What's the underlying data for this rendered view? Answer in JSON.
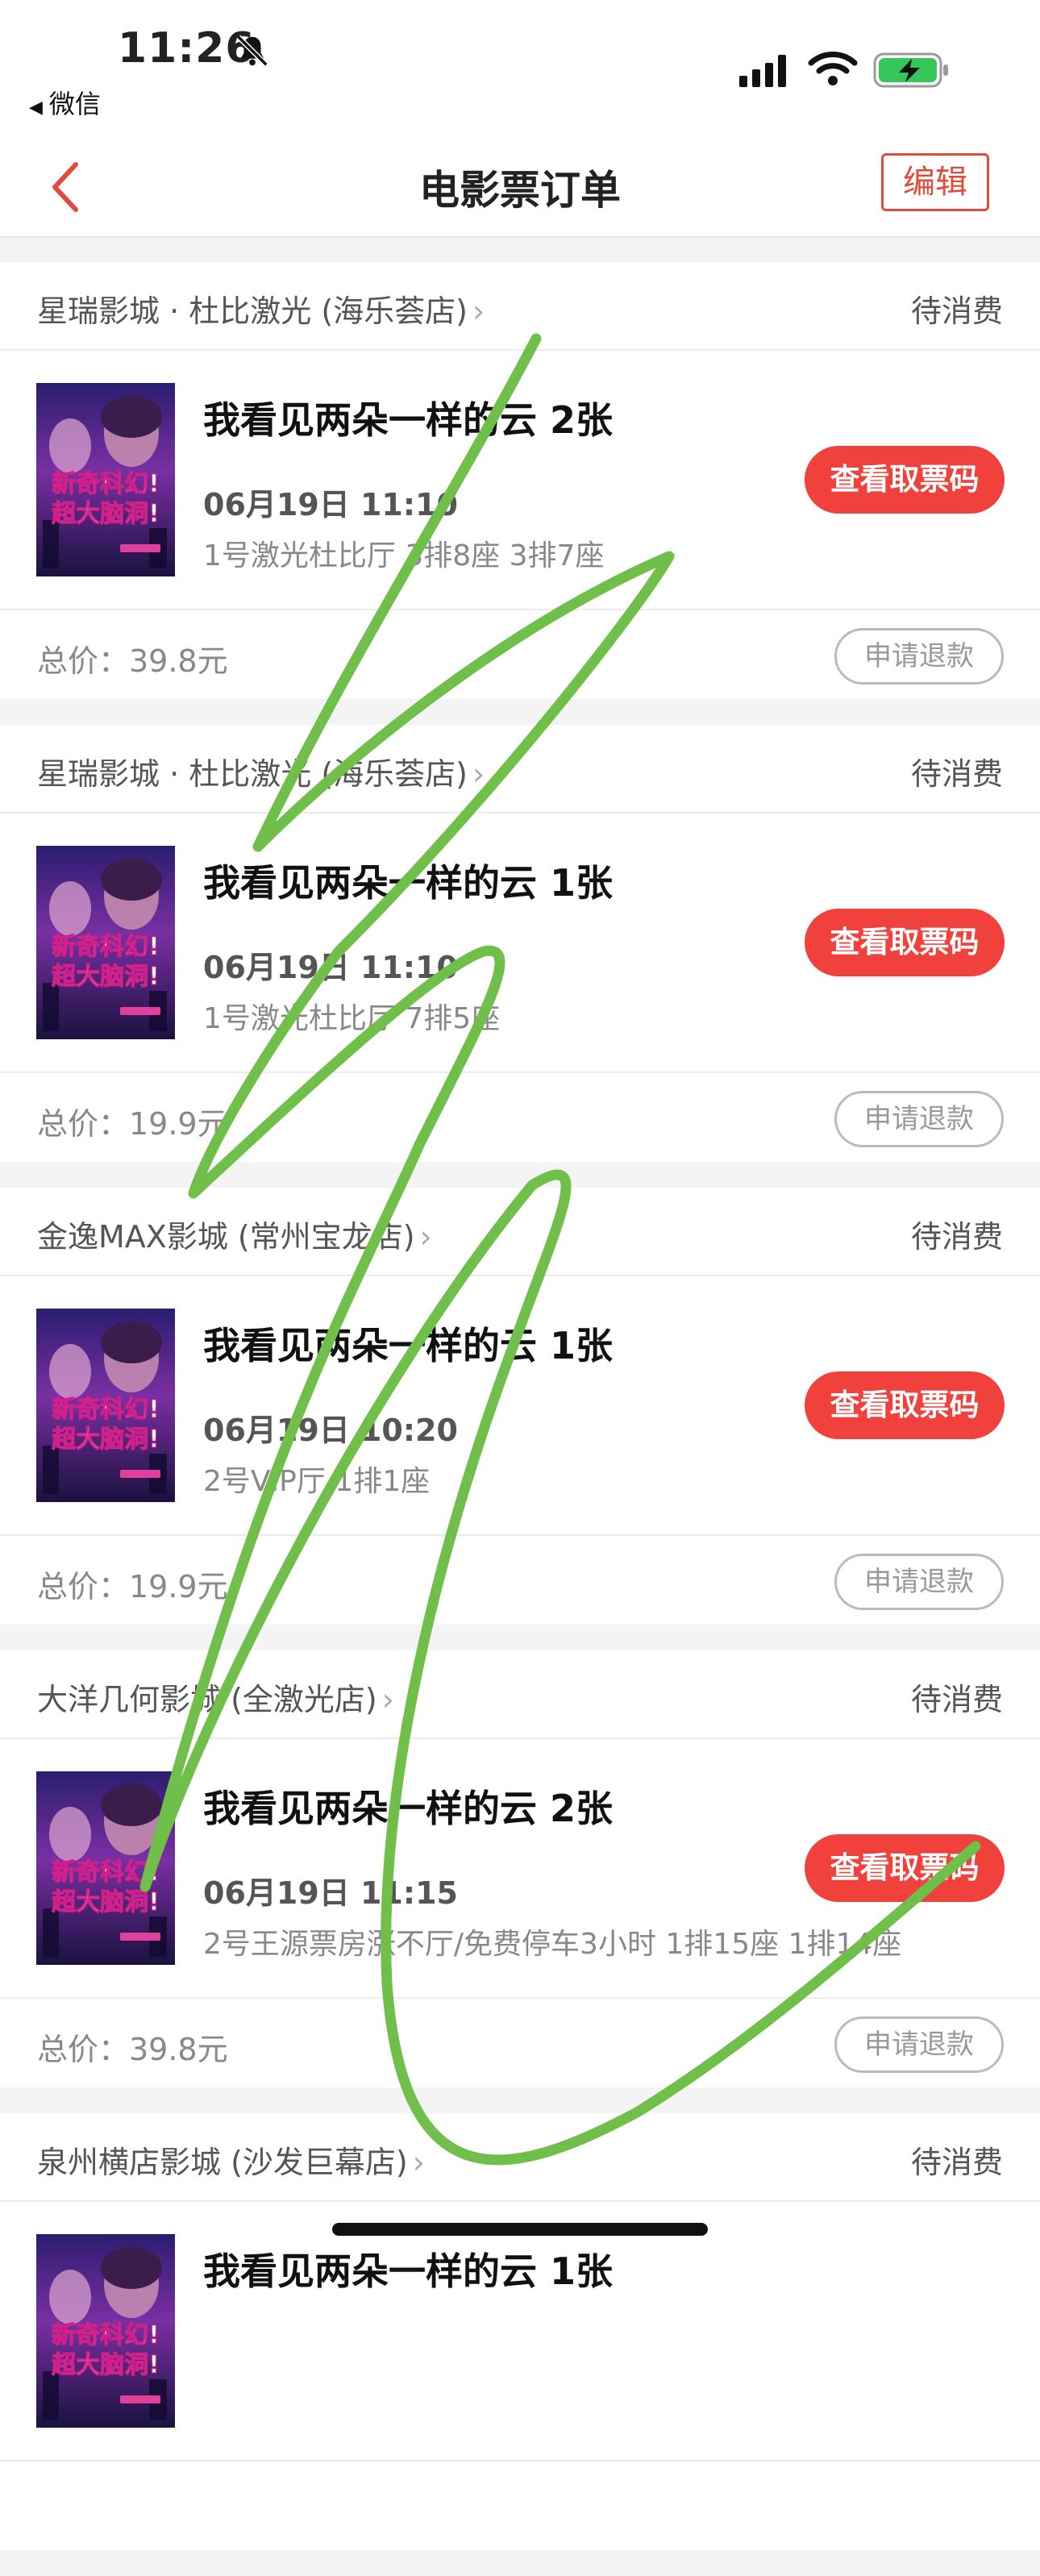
{
  "status_bar": {
    "time": "11:26",
    "back_app": "微信"
  },
  "nav": {
    "title": "电影票订单",
    "edit_label": "编辑"
  },
  "orders": [
    {
      "cinema": "星瑞影城 · 杜比激光 (海乐荟店)",
      "status": "待消费",
      "movie": "我看见两朵一样的云 2张",
      "showtime": "06月19日 11:10",
      "seats": "1号激光杜比厅 3排8座 3排7座",
      "ticket_button": "查看取票码",
      "price": "总价：39.8元",
      "refund_button": "申请退款"
    },
    {
      "cinema": "星瑞影城 · 杜比激光 (海乐荟店)",
      "status": "待消费",
      "movie": "我看见两朵一样的云 1张",
      "showtime": "06月19日 11:10",
      "seats": "1号激光杜比厅 7排5座",
      "ticket_button": "查看取票码",
      "price": "总价：19.9元",
      "refund_button": "申请退款"
    },
    {
      "cinema": "金逸MAX影城 (常州宝龙店)",
      "status": "待消费",
      "movie": "我看见两朵一样的云 1张",
      "showtime": "06月19日 10:20",
      "seats": "2号VIP厅 1排1座",
      "ticket_button": "查看取票码",
      "price": "总价：19.9元",
      "refund_button": "申请退款"
    },
    {
      "cinema": "大洋几何影城 (全激光店)",
      "status": "待消费",
      "movie": "我看见两朵一样的云 2张",
      "showtime": "06月19日 11:15",
      "seats": "2号王源票房涨不厅/免费停车3小时 1排15座 1排14座",
      "ticket_button": "查看取票码",
      "price": "总价：39.8元",
      "refund_button": "申请退款"
    },
    {
      "cinema": "泉州横店影城 (沙发巨幕店)",
      "status": "待消费",
      "movie": "我看见两朵一样的云 1张",
      "showtime": "",
      "seats": "",
      "ticket_button": "",
      "price": "",
      "refund_button": ""
    }
  ],
  "poster": {
    "line1": "新奇科幻!",
    "line2": "超大脑洞!"
  },
  "colors": {
    "accent": "#f0413c",
    "scribble": "#6fbf4a"
  },
  "icons": {
    "nav_back": "chevron-left-icon",
    "bell": "bell-slash-icon",
    "signal": "signal-icon",
    "wifi": "wifi-icon",
    "battery": "battery-charging-icon"
  }
}
